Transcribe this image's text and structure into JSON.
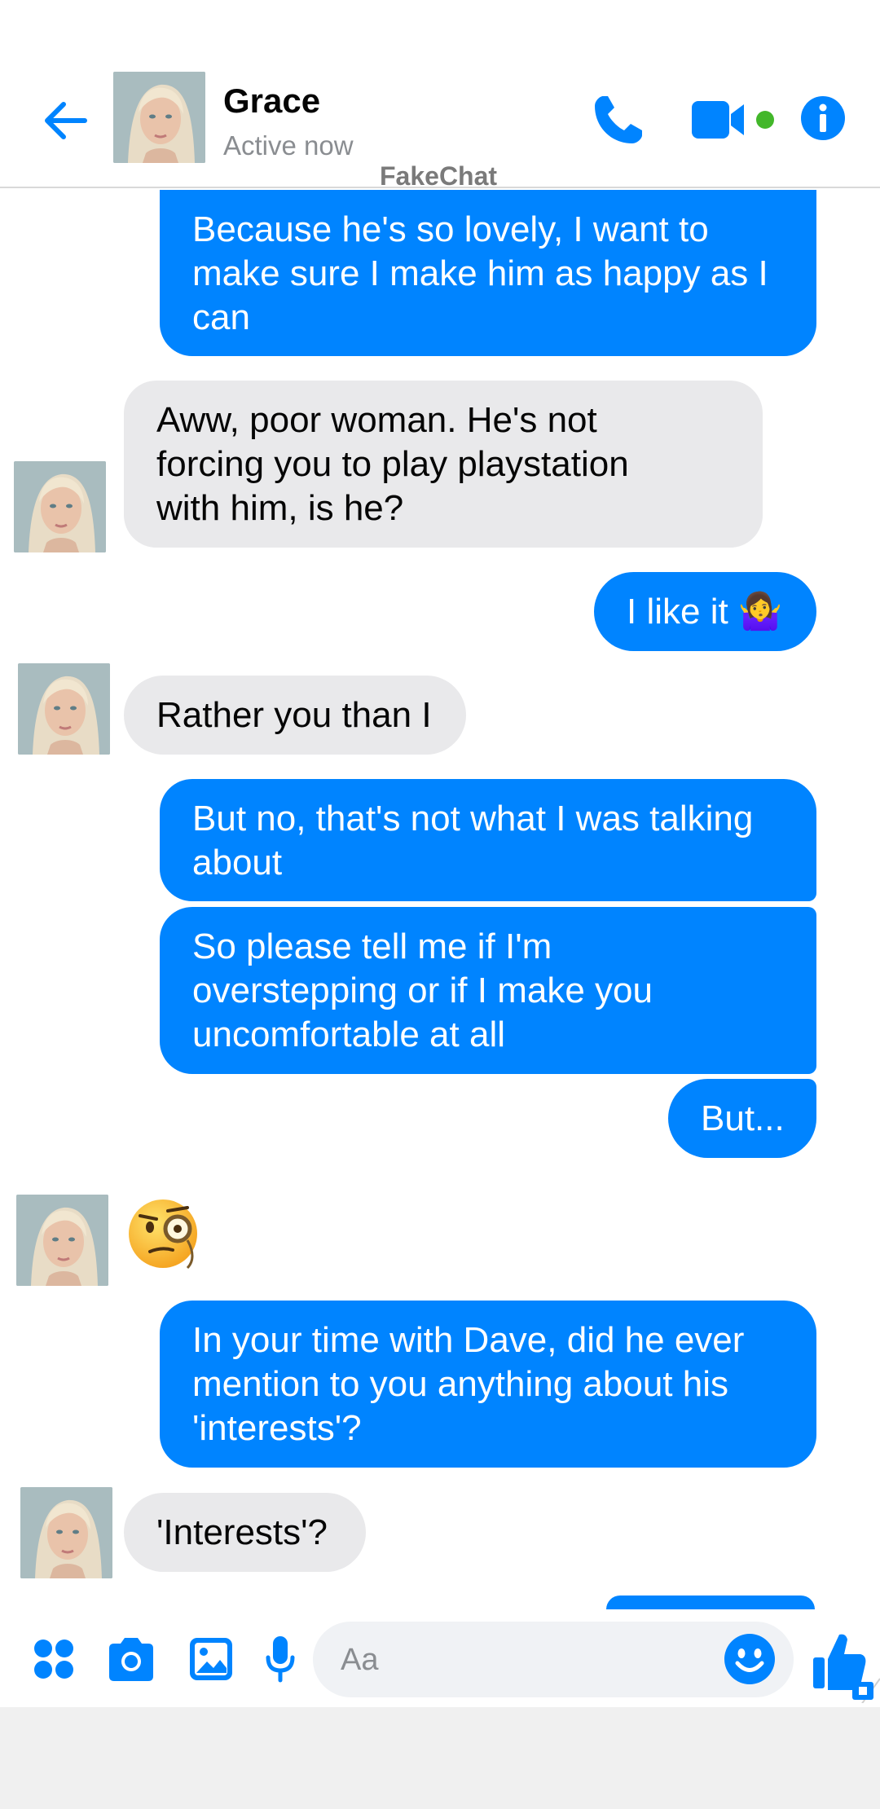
{
  "header": {
    "contact_name": "Grace",
    "status": "Active now",
    "watermark": "FakeChat"
  },
  "colors": {
    "accent": "#0084ff",
    "incoming_bubble": "#e9e9eb",
    "online": "#42b72a"
  },
  "messages": [
    {
      "sender": "me",
      "lines": [
        "Because he's so lovely, I want to",
        "make sure I make him as happy as I",
        "can"
      ]
    },
    {
      "sender": "Grace",
      "lines": [
        "Aww, poor woman. He's not",
        "forcing you to play playstation",
        "with him, is he?"
      ]
    },
    {
      "sender": "me",
      "lines": [
        "I like it 🤷‍♀️"
      ]
    },
    {
      "sender": "Grace",
      "lines": [
        "Rather you than I"
      ]
    },
    {
      "sender": "me",
      "lines": [
        "But no, that's not what I was talking",
        "about"
      ]
    },
    {
      "sender": "me",
      "lines": [
        "So please tell me if I'm",
        "overstepping or if I make you",
        "uncomfortable at all"
      ]
    },
    {
      "sender": "me",
      "lines": [
        "But..."
      ]
    },
    {
      "sender": "Grace",
      "emoji": "face-with-monocle"
    },
    {
      "sender": "me",
      "lines": [
        "In your time with Dave, did he ever",
        "mention to you anything about his",
        "'interests'?"
      ]
    },
    {
      "sender": "Grace",
      "lines": [
        "'Interests'?"
      ]
    }
  ],
  "composer": {
    "placeholder": "Aa"
  },
  "icons": {
    "back": "arrow-left-icon",
    "call": "phone-icon",
    "video": "video-camera-icon",
    "info": "info-icon",
    "apps": "apps-grid-icon",
    "camera": "camera-icon",
    "gallery": "image-icon",
    "mic": "microphone-icon",
    "emoji": "smiley-icon",
    "like": "thumbs-up-icon"
  }
}
